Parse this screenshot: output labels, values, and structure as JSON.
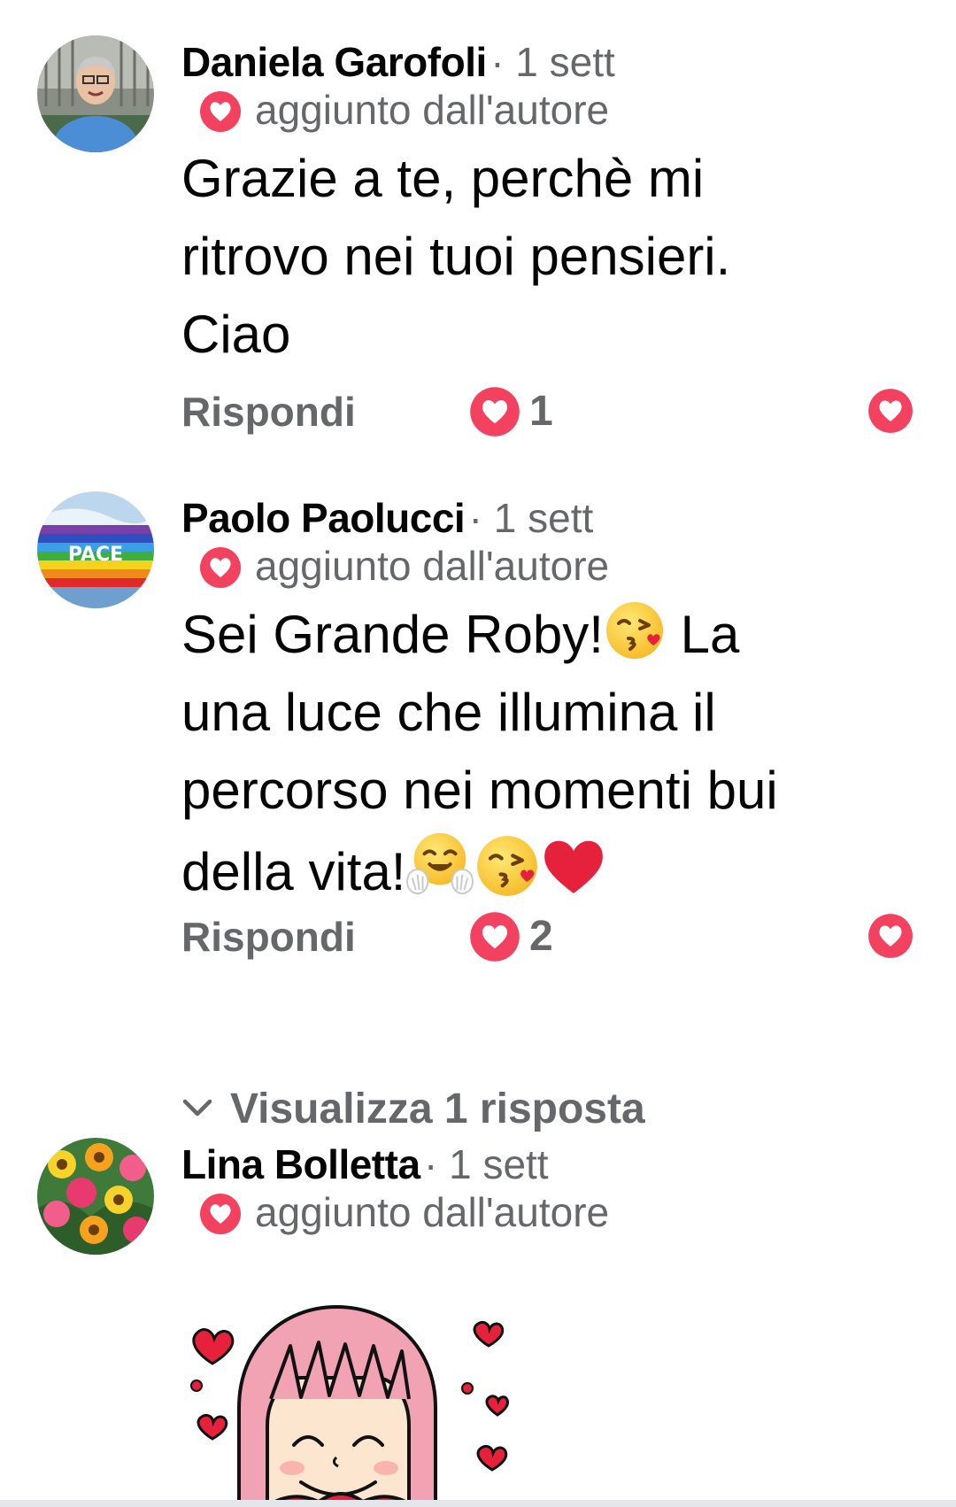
{
  "comments": [
    {
      "author": "Daniela Garofoli",
      "time": "· 1 sett",
      "badge": "aggiunto dall'autore",
      "text_lines": [
        "Grazie a te, perchè mi",
        "ritrovo nei tuoi pensieri.",
        "Ciao"
      ],
      "reply_label": "Rispondi",
      "reaction_count": "1",
      "avatar_icon": "person-photo-avatar"
    },
    {
      "author": "Paolo Paolucci",
      "time": "· 1 sett",
      "badge": "aggiunto dall'autore",
      "text_line1": "Sei Grande Roby!",
      "text_line1_end": " La",
      "text_line2": "una luce che illumina il",
      "text_line3": "percorso nei momenti bui",
      "text_line4": "della vita!",
      "avatar_text": "PACE",
      "reply_label": "Rispondi",
      "reaction_count": "2",
      "view_replies": "Visualizza 1 risposta",
      "avatar_icon": "rainbow-pace-flag-avatar"
    },
    {
      "author": "Lina Bolletta",
      "time": "· 1 sett",
      "badge": "aggiunto dall'autore",
      "avatar_icon": "flowers-bouquet-avatar",
      "sticker_icon": "pink-hair-girl-hearts-sticker"
    }
  ],
  "colors": {
    "heart_red": "#f3425f",
    "secondary_text": "#65676b",
    "primary_text": "#050505"
  },
  "icons": {
    "reaction": "love-heart-icon",
    "chevron": "chevron-down-icon",
    "emoji_kiss": "face-blowing-kiss-emoji",
    "emoji_hug": "hugging-face-emoji",
    "emoji_heart": "red-heart-emoji"
  }
}
